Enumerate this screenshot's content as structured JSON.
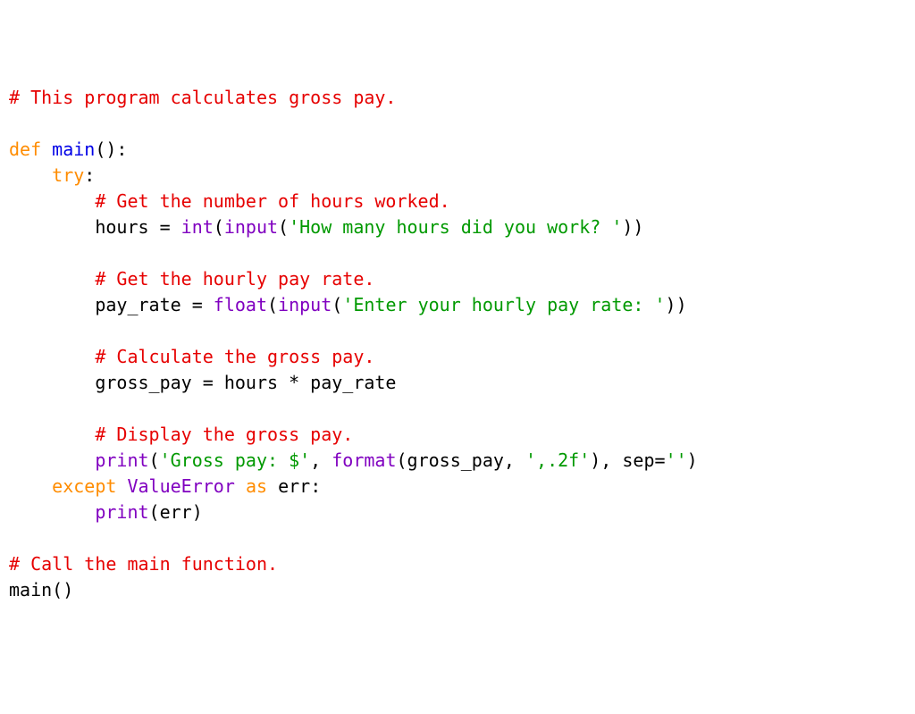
{
  "lines": [
    [
      {
        "cls": "c-comment",
        "t": "# This program calculates gross pay."
      }
    ],
    [
      {
        "cls": "c-plain",
        "t": ""
      }
    ],
    [
      {
        "cls": "c-kw",
        "t": "def"
      },
      {
        "cls": "c-plain",
        "t": " "
      },
      {
        "cls": "c-func",
        "t": "main"
      },
      {
        "cls": "c-plain",
        "t": "():"
      }
    ],
    [
      {
        "cls": "c-plain",
        "t": "    "
      },
      {
        "cls": "c-kw",
        "t": "try"
      },
      {
        "cls": "c-plain",
        "t": ":"
      }
    ],
    [
      {
        "cls": "c-plain",
        "t": "        "
      },
      {
        "cls": "c-comment",
        "t": "# Get the number of hours worked."
      }
    ],
    [
      {
        "cls": "c-plain",
        "t": "        hours = "
      },
      {
        "cls": "c-builtin",
        "t": "int"
      },
      {
        "cls": "c-plain",
        "t": "("
      },
      {
        "cls": "c-builtin",
        "t": "input"
      },
      {
        "cls": "c-plain",
        "t": "("
      },
      {
        "cls": "c-str",
        "t": "'How many hours did you work? '"
      },
      {
        "cls": "c-plain",
        "t": "))"
      }
    ],
    [
      {
        "cls": "c-plain",
        "t": ""
      }
    ],
    [
      {
        "cls": "c-plain",
        "t": "        "
      },
      {
        "cls": "c-comment",
        "t": "# Get the hourly pay rate."
      }
    ],
    [
      {
        "cls": "c-plain",
        "t": "        pay_rate = "
      },
      {
        "cls": "c-builtin",
        "t": "float"
      },
      {
        "cls": "c-plain",
        "t": "("
      },
      {
        "cls": "c-builtin",
        "t": "input"
      },
      {
        "cls": "c-plain",
        "t": "("
      },
      {
        "cls": "c-str",
        "t": "'Enter your hourly pay rate: '"
      },
      {
        "cls": "c-plain",
        "t": "))"
      }
    ],
    [
      {
        "cls": "c-plain",
        "t": ""
      }
    ],
    [
      {
        "cls": "c-plain",
        "t": "        "
      },
      {
        "cls": "c-comment",
        "t": "# Calculate the gross pay."
      }
    ],
    [
      {
        "cls": "c-plain",
        "t": "        gross_pay = hours * pay_rate"
      }
    ],
    [
      {
        "cls": "c-plain",
        "t": ""
      }
    ],
    [
      {
        "cls": "c-plain",
        "t": "        "
      },
      {
        "cls": "c-comment",
        "t": "# Display the gross pay."
      }
    ],
    [
      {
        "cls": "c-plain",
        "t": "        "
      },
      {
        "cls": "c-builtin",
        "t": "print"
      },
      {
        "cls": "c-plain",
        "t": "("
      },
      {
        "cls": "c-str",
        "t": "'Gross pay: $'"
      },
      {
        "cls": "c-plain",
        "t": ", "
      },
      {
        "cls": "c-builtin",
        "t": "format"
      },
      {
        "cls": "c-plain",
        "t": "(gross_pay, "
      },
      {
        "cls": "c-str",
        "t": "',.2f'"
      },
      {
        "cls": "c-plain",
        "t": "), sep="
      },
      {
        "cls": "c-str",
        "t": "''"
      },
      {
        "cls": "c-plain",
        "t": ")"
      }
    ],
    [
      {
        "cls": "c-plain",
        "t": "    "
      },
      {
        "cls": "c-kw",
        "t": "except"
      },
      {
        "cls": "c-plain",
        "t": " "
      },
      {
        "cls": "c-builtin",
        "t": "ValueError"
      },
      {
        "cls": "c-plain",
        "t": " "
      },
      {
        "cls": "c-kw",
        "t": "as"
      },
      {
        "cls": "c-plain",
        "t": " err:"
      }
    ],
    [
      {
        "cls": "c-plain",
        "t": "        "
      },
      {
        "cls": "c-builtin",
        "t": "print"
      },
      {
        "cls": "c-plain",
        "t": "(err)"
      }
    ],
    [
      {
        "cls": "c-plain",
        "t": ""
      }
    ],
    [
      {
        "cls": "c-comment",
        "t": "# Call the main function."
      }
    ],
    [
      {
        "cls": "c-plain",
        "t": "main()"
      }
    ]
  ]
}
